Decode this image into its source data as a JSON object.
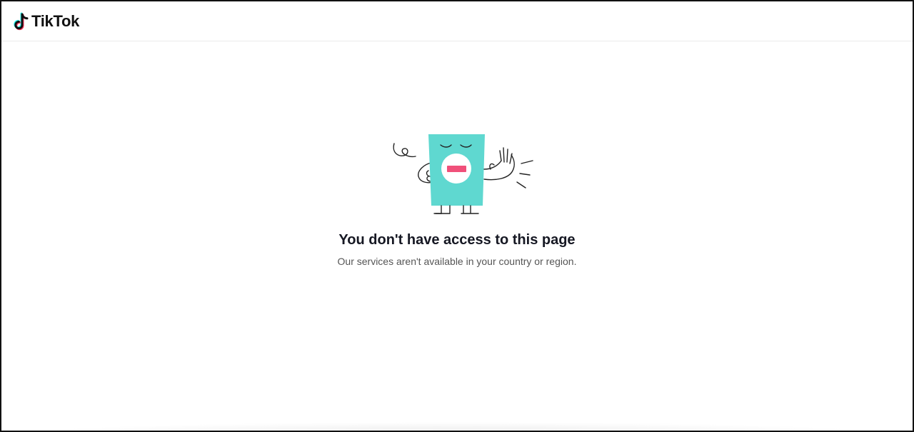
{
  "header": {
    "logo_text": "TikTok",
    "logo_icon": "tiktok-note-icon"
  },
  "error": {
    "illustration": "blocked-character-illustration",
    "title": "You don't have access to this page",
    "message": "Our services aren't available in your country or region."
  },
  "colors": {
    "character_body": "#5fd8d0",
    "mouth_bar": "#f0507a",
    "title_text": "#161823",
    "message_text": "#555555"
  }
}
